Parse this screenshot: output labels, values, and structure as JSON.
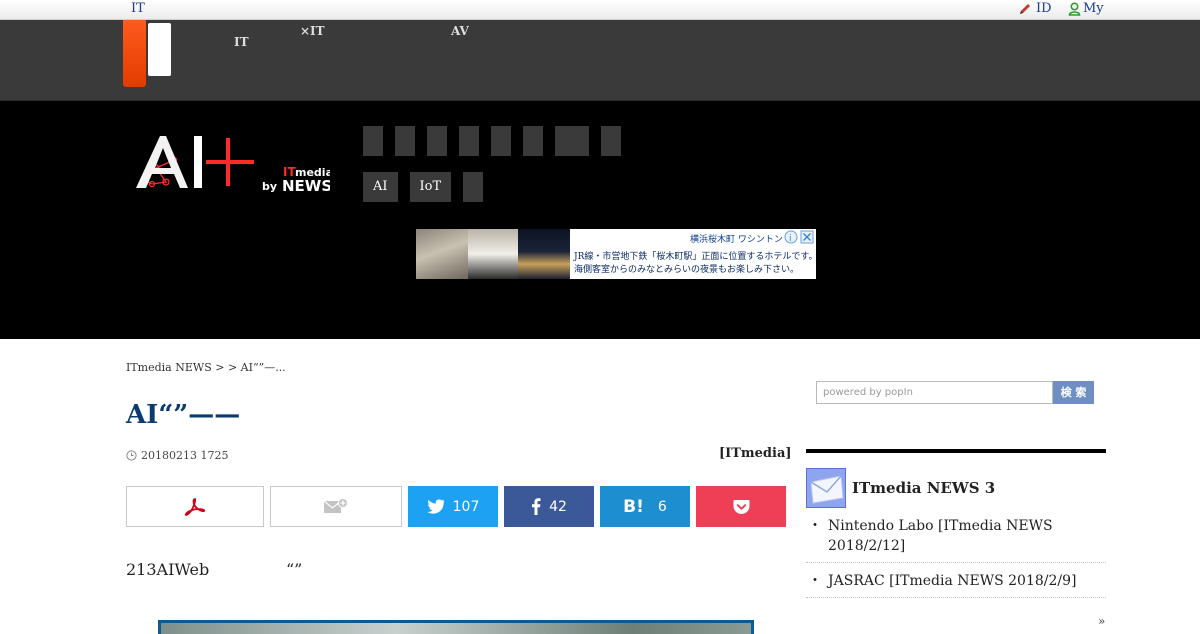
{
  "topbar": {
    "site_label": "IT",
    "login_label": "ID",
    "my_label": "My"
  },
  "brandbar": {
    "channels": [
      {
        "line1": "",
        "line2": "IT"
      },
      {
        "line1": "",
        "line2": "×IT"
      },
      {
        "line1": "AV",
        "line2": ""
      }
    ]
  },
  "hero": {
    "tags": [
      "AI",
      "IoT",
      ""
    ],
    "ad": {
      "title": "横浜桜木町 ワシントン",
      "line1": "JR線・市営地下鉄「桜木町駅」正面に位置するホテルです。",
      "line2": "海側客室からのみなとみらいの夜景もお楽しみ下さい。"
    }
  },
  "breadcrumb": "ITmedia NEWS >  > AI“”—...",
  "article": {
    "title": "AI“”——",
    "date": "20180213 1725",
    "byline": "[ITmedia]",
    "lead": "213AIWeb",
    "lead_quote": "“”"
  },
  "share": {
    "twitter_count": "107",
    "facebook_count": "42",
    "hatena_label": "B!",
    "hatena_count": "6"
  },
  "search": {
    "placeholder": "powered by popIn",
    "button_label": "検 索"
  },
  "ranking": {
    "title": "ITmedia NEWS 3",
    "items": [
      {
        "bullet": "・",
        "text": "Nintendo Labo [ITmedia NEWS 2018/2/12]"
      },
      {
        "bullet": "・",
        "text": "JASRAC [ITmedia NEWS 2018/2/9]"
      }
    ],
    "more": "»"
  },
  "colors": {
    "brand_orange": "#ff5a1f",
    "title_blue": "#0a3a6e",
    "twitter": "#1da1f2",
    "facebook": "#3b5998",
    "hatena": "#1d8ecf",
    "pocket": "#ef3f56"
  }
}
